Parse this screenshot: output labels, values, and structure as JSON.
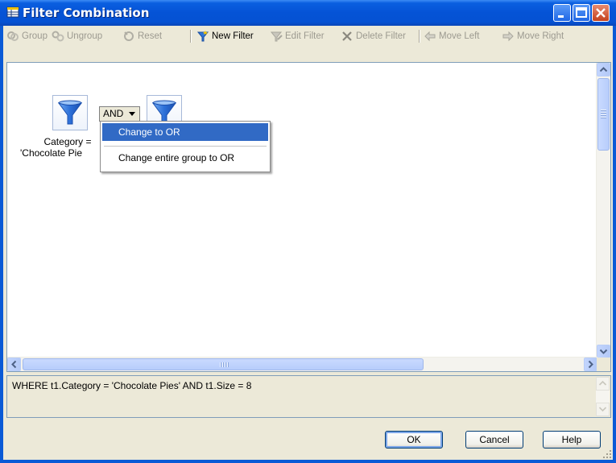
{
  "window": {
    "title": "Filter Combination"
  },
  "toolbar": {
    "items": [
      {
        "label": "Group",
        "icon": "group-icon",
        "enabled": false
      },
      {
        "label": "Ungroup",
        "icon": "ungroup-icon",
        "enabled": false
      },
      {
        "label": "Reset",
        "icon": "reset-icon",
        "enabled": false
      },
      {
        "label": "New Filter",
        "icon": "new-filter-icon",
        "enabled": true
      },
      {
        "label": "Edit Filter",
        "icon": "edit-filter-icon",
        "enabled": false
      },
      {
        "label": "Delete Filter",
        "icon": "delete-icon",
        "enabled": false
      },
      {
        "label": "Move Left",
        "icon": "arrow-left-icon",
        "enabled": false
      },
      {
        "label": "Move Right",
        "icon": "arrow-right-icon",
        "enabled": false
      }
    ]
  },
  "canvas": {
    "filter1_label_line1": "Category =",
    "filter1_label_line2": "'Chocolate Pie",
    "operator": "AND"
  },
  "context_menu": {
    "items": [
      {
        "label": "Change to OR",
        "selected": true
      },
      {
        "label": "Change entire group to OR",
        "selected": false
      }
    ]
  },
  "sql": {
    "text": "WHERE t1.Category = 'Chocolate Pies' AND t1.Size = 8"
  },
  "buttons": {
    "ok": "OK",
    "cancel": "Cancel",
    "help": "Help"
  },
  "colors": {
    "title_bar": "#0553d6",
    "menu_highlight": "#316ac5",
    "face": "#ece9d8"
  }
}
